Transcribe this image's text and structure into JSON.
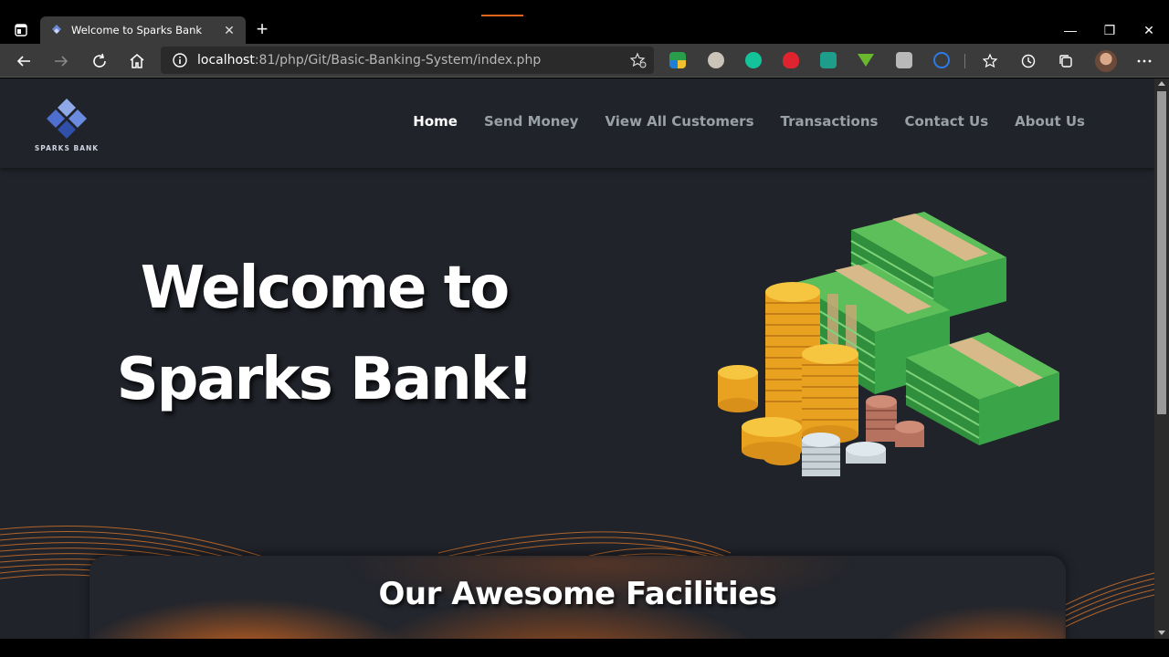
{
  "browser": {
    "tab_title": "Welcome to Sparks Bank",
    "url_host": "localhost",
    "url_rest": ":81/php/Git/Basic-Banking-System/index.php",
    "new_tab_symbol": "+",
    "close_tab_symbol": "✕",
    "window_controls": {
      "minimize": "—",
      "restore": "❐",
      "close": "✕"
    },
    "accent_color": "#e0651c"
  },
  "site": {
    "brand": "SPARKS BANK",
    "nav": [
      {
        "label": "Home",
        "active": true
      },
      {
        "label": "Send Money",
        "active": false
      },
      {
        "label": "View All Customers",
        "active": false
      },
      {
        "label": "Transactions",
        "active": false
      },
      {
        "label": "Contact Us",
        "active": false
      },
      {
        "label": "About Us",
        "active": false
      }
    ],
    "hero_line1": "Welcome to",
    "hero_line2": "Sparks Bank!",
    "facilities_heading": "Our Awesome Facilities",
    "colors": {
      "background": "#20232a",
      "wave": "#e07a2a",
      "money_green": "#3fa34d",
      "coin_gold": "#f2b72a"
    }
  }
}
